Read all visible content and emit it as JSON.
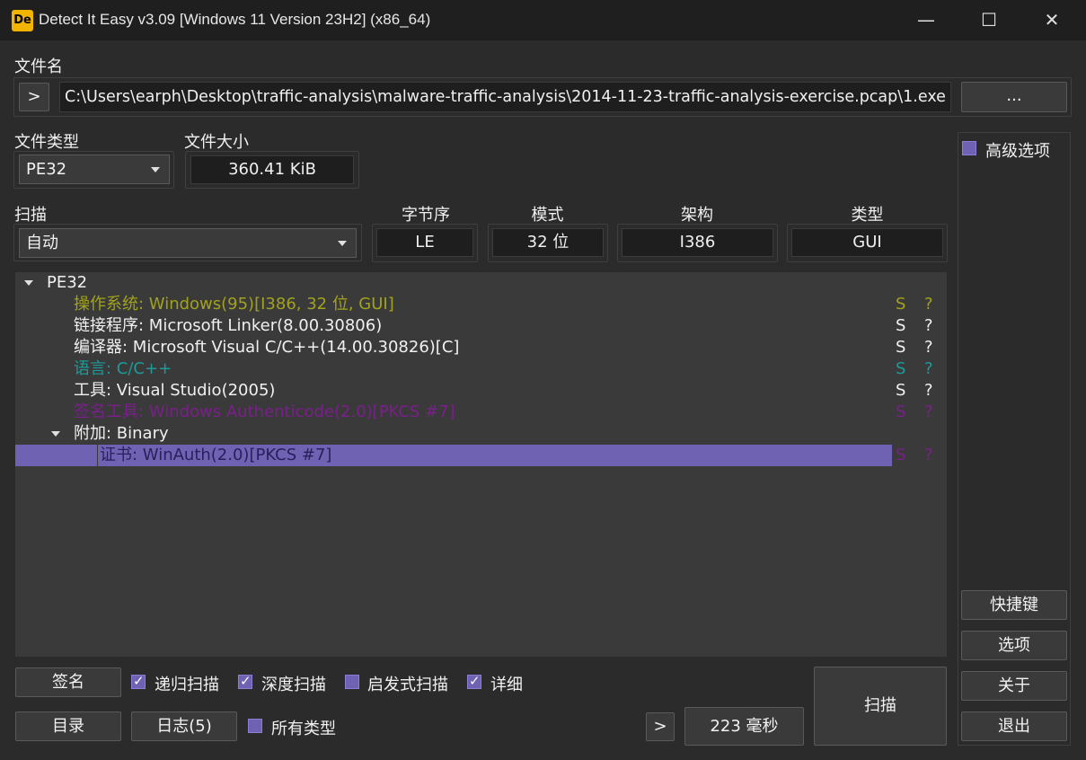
{
  "window": {
    "title": "Detect It Easy v3.09 [Windows 11 Version 23H2] (x86_64)",
    "logo_text": "De",
    "minimize_glyph": "—",
    "maximize_glyph": "☐",
    "close_glyph": "✕"
  },
  "file": {
    "label": "文件名",
    "nav_button": ">",
    "path": "C:\\Users\\earph\\Desktop\\traffic-analysis\\malware-traffic-analysis\\2014-11-23-traffic-analysis-exercise.pcap\\1.exe",
    "browse_button": "..."
  },
  "file_type": {
    "label": "文件类型",
    "value": "PE32"
  },
  "file_size": {
    "label": "文件大小",
    "value": "360.41 KiB"
  },
  "scan_mode": {
    "label": "扫描",
    "value": "自动"
  },
  "info": {
    "endian": {
      "label": "字节序",
      "value": "LE"
    },
    "mode": {
      "label": "模式",
      "value": "32 位"
    },
    "arch": {
      "label": "架构",
      "value": "I386"
    },
    "type": {
      "label": "类型",
      "value": "GUI"
    }
  },
  "colors": {
    "os": "#a2a21b",
    "lang": "#1e9a9a",
    "sign": "#7a1f8c",
    "selected": "#6f62b3",
    "accent": "#6f62b3"
  },
  "results": {
    "root": "PE32",
    "rows": [
      {
        "text": "操作系统: Windows(95)[I386, 32 位, GUI]",
        "s": "S",
        "q": "?"
      },
      {
        "text": "链接程序: Microsoft Linker(8.00.30806)",
        "s": "S",
        "q": "?"
      },
      {
        "text": "编译器: Microsoft Visual C/C++(14.00.30826)[C]",
        "s": "S",
        "q": "?"
      },
      {
        "text": "语言: C/C++",
        "s": "S",
        "q": "?"
      },
      {
        "text": "工具: Visual Studio(2005)",
        "s": "S",
        "q": "?"
      },
      {
        "text": "签名工具: Windows Authenticode(2.0)[PKCS #7]",
        "s": "S",
        "q": "?"
      }
    ],
    "overlay": "附加: Binary",
    "cert": {
      "text": "证书: WinAuth(2.0)[PKCS #7]",
      "s": "S",
      "q": "?"
    }
  },
  "bottom": {
    "signature_button": "签名",
    "recursive": {
      "label": "递归扫描",
      "checked": true
    },
    "deep": {
      "label": "深度扫描",
      "checked": true
    },
    "heuristic": {
      "label": "启发式扫描",
      "checked": false
    },
    "verbose": {
      "label": "详细",
      "checked": true
    },
    "directory_button": "目录",
    "log_button": "日志(5)",
    "all_types": {
      "label": "所有类型",
      "checked": false
    },
    "time_nav": ">",
    "time": "223 毫秒",
    "scan_button": "扫描"
  },
  "sidebar": {
    "advanced": {
      "label": "高级选项",
      "checked": false
    },
    "shortcuts_button": "快捷键",
    "options_button": "选项",
    "about_button": "关于",
    "exit_button": "退出"
  }
}
